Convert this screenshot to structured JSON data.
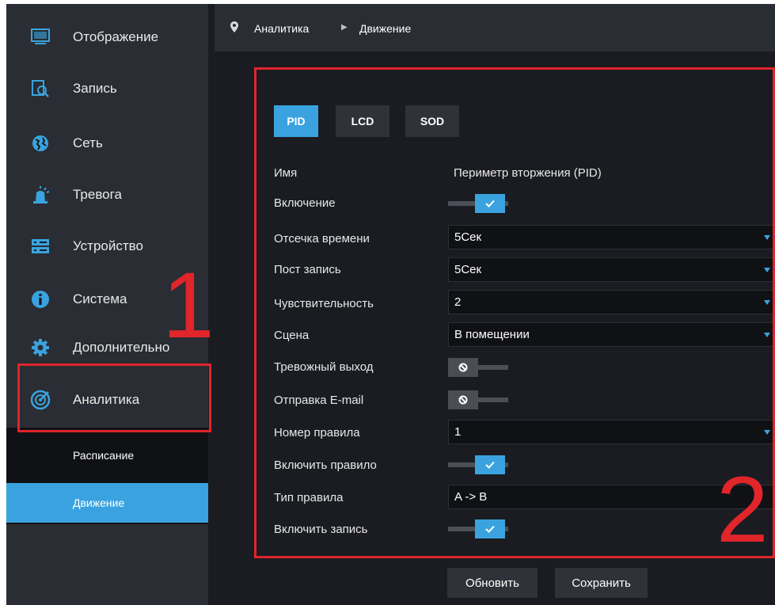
{
  "sidebar": {
    "items": [
      {
        "label": "Отображение",
        "icon": "monitor-icon"
      },
      {
        "label": "Запись",
        "icon": "record-search-icon"
      },
      {
        "label": "Сеть",
        "icon": "globe-icon"
      },
      {
        "label": "Тревога",
        "icon": "alarm-siren-icon"
      },
      {
        "label": "Устройство",
        "icon": "hdd-icon"
      },
      {
        "label": "Система",
        "icon": "info-icon"
      },
      {
        "label": "Дополнительно",
        "icon": "gear-icon"
      },
      {
        "label": "Аналитика",
        "icon": "radar-icon"
      }
    ],
    "sub_items": [
      {
        "label": "Расписание"
      },
      {
        "label": "Движение"
      }
    ]
  },
  "header": {
    "crumb1": "Аналитика",
    "crumb2": "Движение"
  },
  "tabs": [
    {
      "label": "PID"
    },
    {
      "label": "LCD"
    },
    {
      "label": "SOD"
    }
  ],
  "form": {
    "name_label": "Имя",
    "name_value": "Периметр вторжения (PID)",
    "enable_label": "Включение",
    "time_cutoff_label": "Отсечка времени",
    "time_cutoff_value": "5Сек",
    "post_record_label": "Пост запись",
    "post_record_value": "5Сек",
    "sensitivity_label": "Чувствительность",
    "sensitivity_value": "2",
    "scene_label": "Сцена",
    "scene_value": "В помещении",
    "alarm_out_label": "Тревожный выход",
    "email_label": "Отправка E-mail",
    "rule_number_label": "Номер правила",
    "rule_number_value": "1",
    "rule_enable_label": "Включить правило",
    "rule_type_label": "Тип правила",
    "rule_type_value": "A -> B",
    "record_enable_label": "Включить запись"
  },
  "buttons": {
    "refresh": "Обновить",
    "save": "Сохранить"
  },
  "annotations": {
    "num1": "1",
    "num2": "2"
  },
  "colors": {
    "accent": "#3aa3df",
    "annotation": "#e0252b",
    "sidebar_bg": "#2a2d33",
    "main_bg": "#1a1c21"
  }
}
